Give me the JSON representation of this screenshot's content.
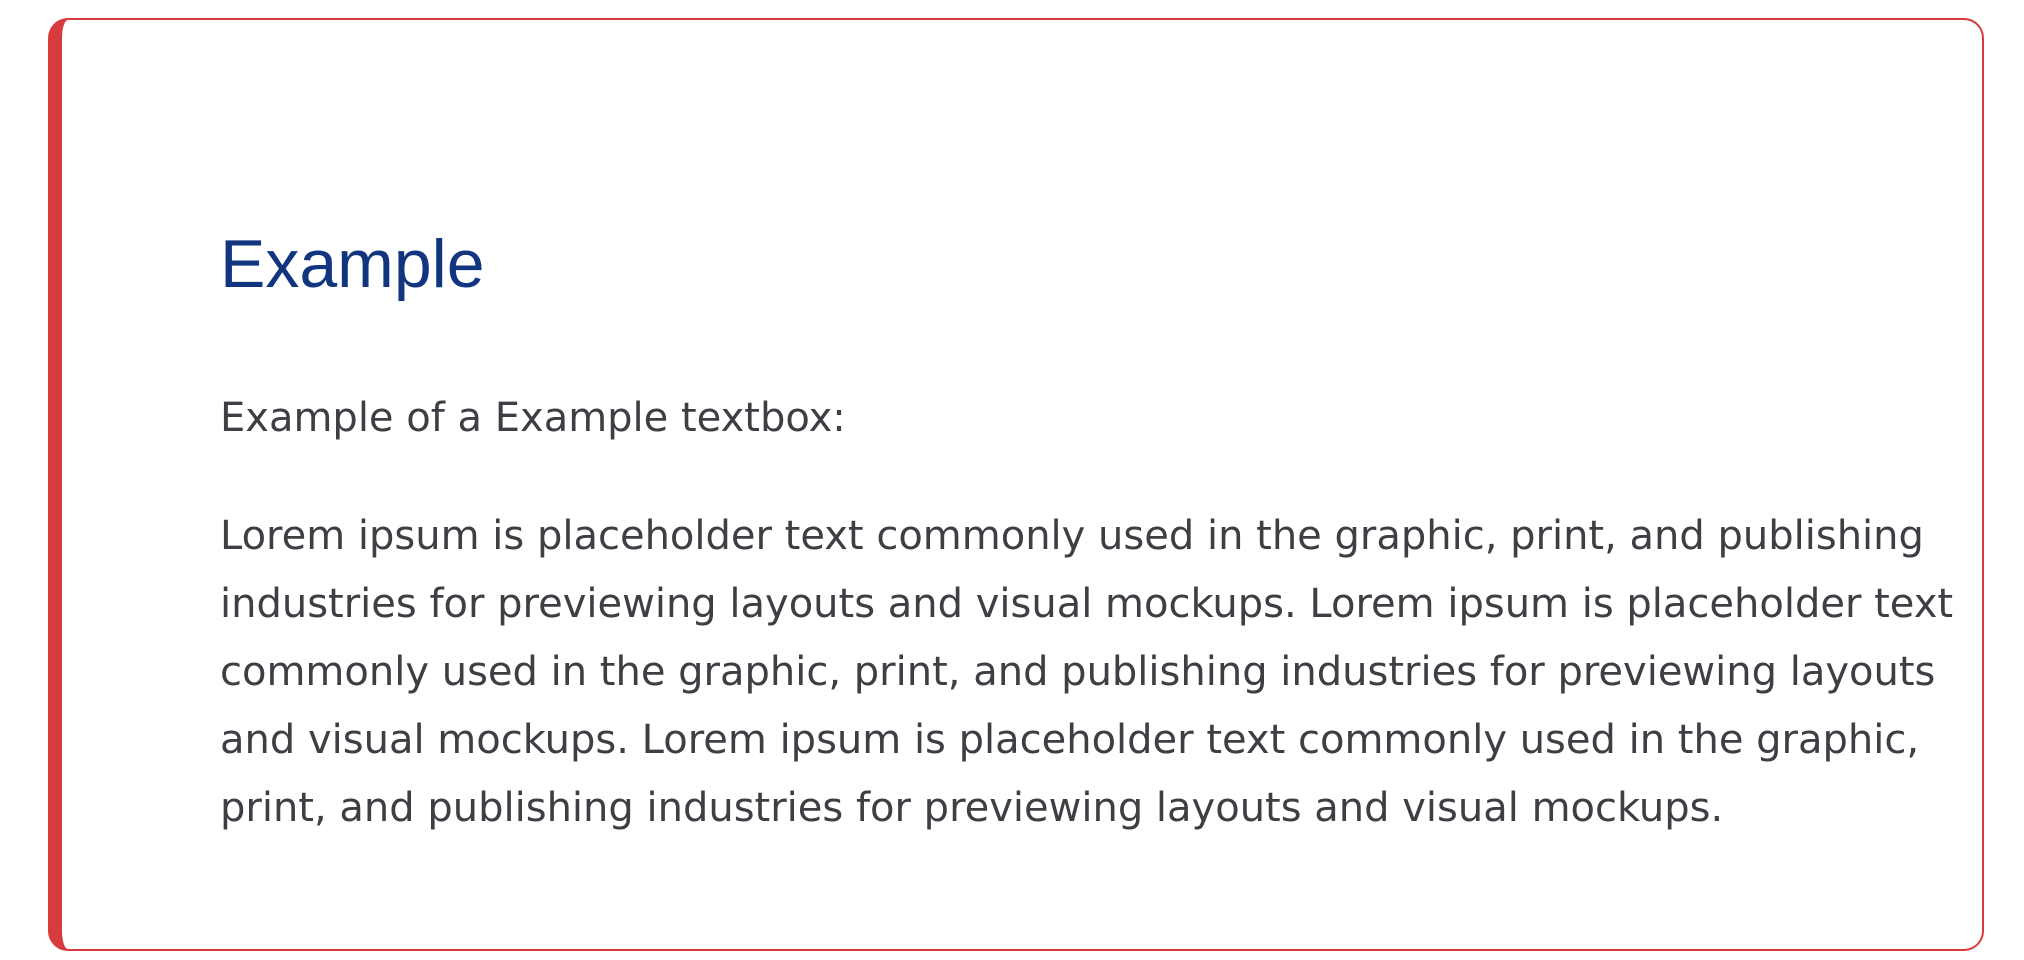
{
  "callout": {
    "title": "Example",
    "intro": "Example of a Example textbox:",
    "body": "Lorem ipsum is placeholder text commonly used in the graphic, print, and publishing industries for previewing layouts and visual mockups. Lorem ipsum is placeholder text commonly used in the graphic, print, and publishing industries for previewing layouts and visual mockups. Lorem ipsum is placeholder text commonly used in the graphic, print, and publishing industries for previewing layouts and visual mockups.",
    "accent_color": "#d83b3e",
    "title_color": "#12357f",
    "text_color": "#3d3f44"
  }
}
